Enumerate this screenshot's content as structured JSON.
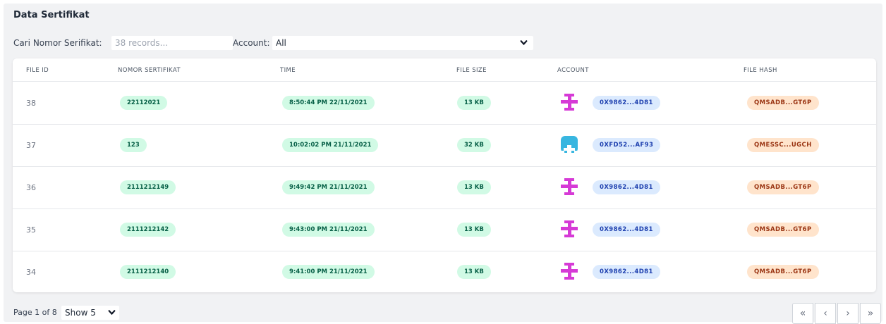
{
  "title": "Data Sertifikat",
  "filters": {
    "search_label": "Cari Nomor Serifikat:",
    "search_placeholder": "38 records...",
    "account_label": "Account:",
    "account_value": "All"
  },
  "table": {
    "headers": [
      "FILE ID",
      "NOMOR SERTIFIKAT",
      "TIME",
      "FILE SIZE",
      "ACCOUNT",
      "FILE HASH"
    ],
    "rows": [
      {
        "id": "38",
        "nomor": "22112021",
        "time": "8:50:44 PM 22/11/2021",
        "size": "13 KB",
        "avatar": "magenta-identicon",
        "account": "0X9862...4D81",
        "hash": "QMSADB...GT6P"
      },
      {
        "id": "37",
        "nomor": "123",
        "time": "10:02:02 PM 21/11/2021",
        "size": "32 KB",
        "avatar": "cyan-identicon",
        "account": "0XFD52...AF93",
        "hash": "QMESSC...UGCH"
      },
      {
        "id": "36",
        "nomor": "2111212149",
        "time": "9:49:42 PM 21/11/2021",
        "size": "13 KB",
        "avatar": "magenta-identicon",
        "account": "0X9862...4D81",
        "hash": "QMSADB...GT6P"
      },
      {
        "id": "35",
        "nomor": "2111212142",
        "time": "9:43:00 PM 21/11/2021",
        "size": "13 KB",
        "avatar": "magenta-identicon",
        "account": "0X9862...4D81",
        "hash": "QMSADB...GT6P"
      },
      {
        "id": "34",
        "nomor": "2111212140",
        "time": "9:41:00 PM 21/11/2021",
        "size": "13 KB",
        "avatar": "magenta-identicon",
        "account": "0X9862...4D81",
        "hash": "QMSADB...GT6P"
      }
    ]
  },
  "footer": {
    "page_info": "Page 1 of 8",
    "show_value": "Show 5",
    "pager": [
      {
        "name": "first-page-button",
        "glyph": "«"
      },
      {
        "name": "prev-page-button",
        "glyph": "‹"
      },
      {
        "name": "next-page-button",
        "glyph": "›"
      },
      {
        "name": "last-page-button",
        "glyph": "»"
      }
    ]
  },
  "colors": {
    "panel_bg": "#f1f2f4",
    "pill_green": "#d1fae5",
    "pill_blue": "#dbeafe",
    "pill_orange": "#ffe4cc",
    "identicon_magenta": "#d63ad6",
    "identicon_cyan": "#38b6e0"
  }
}
